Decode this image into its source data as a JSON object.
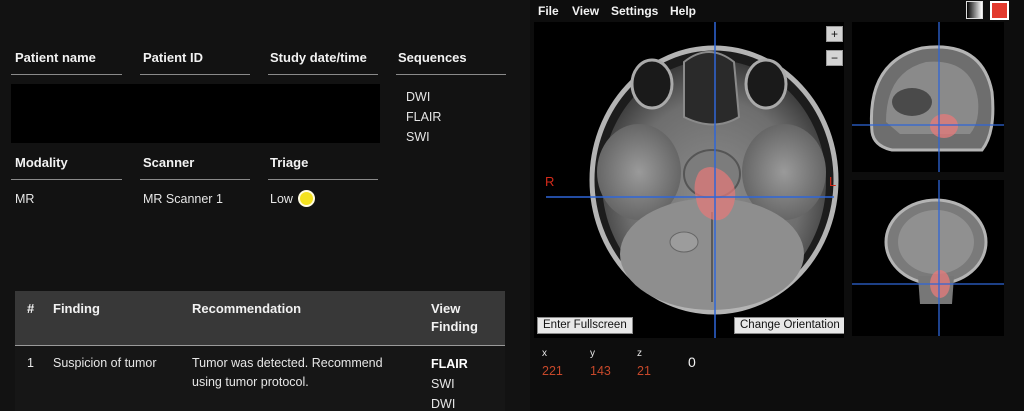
{
  "patient": {
    "headers": {
      "name": "Patient name",
      "id": "Patient ID",
      "study": "Study date/time",
      "sequences": "Sequences",
      "modality": "Modality",
      "scanner": "Scanner",
      "triage": "Triage"
    },
    "sequences": [
      "DWI",
      "FLAIR",
      "SWI"
    ],
    "modality": "MR",
    "scanner": "MR Scanner 1",
    "triage": "Low",
    "triage_color": "#f4e21f"
  },
  "findings": {
    "headers": {
      "num": "#",
      "finding": "Finding",
      "recommendation": "Recommendation",
      "view_line1": "View",
      "view_line2": "Finding"
    },
    "rows": [
      {
        "num": "1",
        "finding": "Suspicion of tumor",
        "recommendation_line1": "Tumor was detected. Recommend",
        "recommendation_line2": "using tumor protocol.",
        "views": [
          "FLAIR",
          "SWI",
          "DWI"
        ]
      }
    ]
  },
  "viewer": {
    "menu": [
      "File",
      "View",
      "Settings",
      "Help"
    ],
    "zoom_in": "+",
    "zoom_out": "−",
    "label_r": "R",
    "label_l": "L",
    "fullscreen_label": "Enter Fullscreen",
    "orientation_label": "Change Orientation",
    "coords": {
      "x_label": "x",
      "y_label": "y",
      "z_label": "z",
      "x": "221",
      "y": "143",
      "z": "21",
      "value": "0"
    },
    "crosshair_color": "#2f66d8",
    "overlay_color": "#e07a7a"
  }
}
